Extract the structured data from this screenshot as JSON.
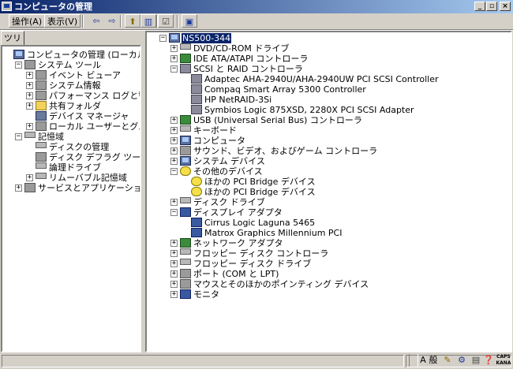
{
  "window": {
    "title": "コンピュータの管理"
  },
  "window_buttons": {
    "minimize": "_",
    "restore": "▫",
    "close": "×"
  },
  "menu": [
    {
      "label": "操作(A)"
    },
    {
      "label": "表示(V)"
    }
  ],
  "toolbar": {
    "back": "⇦",
    "forward": "⇨",
    "up": "⬆",
    "tree": "▥",
    "properties": "☑",
    "help": "▣"
  },
  "left_tab": "ツリー",
  "tree": [
    {
      "label": "コンピュータの管理 (ローカル)",
      "level": 0,
      "expander": "",
      "icon": "computer"
    },
    {
      "label": "システム ツール",
      "level": 1,
      "expander": "−",
      "icon": "tool"
    },
    {
      "label": "イベント ビューア",
      "level": 2,
      "expander": "+",
      "icon": "tool"
    },
    {
      "label": "システム情報",
      "level": 2,
      "expander": "+",
      "icon": "tool"
    },
    {
      "label": "パフォーマンス ログと警告",
      "level": 2,
      "expander": "+",
      "icon": "tool"
    },
    {
      "label": "共有フォルダ",
      "level": 2,
      "expander": "+",
      "icon": "folder"
    },
    {
      "label": "デバイス マネージャ",
      "level": 2,
      "expander": "",
      "icon": "device"
    },
    {
      "label": "ローカル ユーザーとグループ",
      "level": 2,
      "expander": "+",
      "icon": "tool"
    },
    {
      "label": "記憶域",
      "level": 1,
      "expander": "−",
      "icon": "drive"
    },
    {
      "label": "ディスクの管理",
      "level": 2,
      "expander": "",
      "icon": "drive"
    },
    {
      "label": "ディスク デフラグ ツール",
      "level": 2,
      "expander": "",
      "icon": "tool"
    },
    {
      "label": "論理ドライブ",
      "level": 2,
      "expander": "",
      "icon": "drive"
    },
    {
      "label": "リムーバブル記憶域",
      "level": 2,
      "expander": "+",
      "icon": "drive"
    },
    {
      "label": "サービスとアプリケーション",
      "level": 1,
      "expander": "+",
      "icon": "tool"
    }
  ],
  "devices": [
    {
      "label": "NS500-344",
      "level": 0,
      "expander": "−",
      "icon": "computer",
      "selected": true
    },
    {
      "label": "DVD/CD-ROM ドライブ",
      "level": 1,
      "expander": "+",
      "icon": "drive"
    },
    {
      "label": "IDE ATA/ATAPI コントローラ",
      "level": 1,
      "expander": "+",
      "icon": "chip"
    },
    {
      "label": "SCSI と RAID コントローラ",
      "level": 1,
      "expander": "−",
      "icon": "scsi"
    },
    {
      "label": "Adaptec AHA-2940U/AHA-2940UW PCI SCSI Controller",
      "level": 2,
      "expander": "",
      "icon": "scsi"
    },
    {
      "label": "Compaq Smart Array 5300 Controller",
      "level": 2,
      "expander": "",
      "icon": "scsi"
    },
    {
      "label": "HP NetRAID-3Si",
      "level": 2,
      "expander": "",
      "icon": "scsi"
    },
    {
      "label": "Symbios Logic 875XSD, 2280X PCI SCSI Adapter",
      "level": 2,
      "expander": "",
      "icon": "scsi"
    },
    {
      "label": "USB (Universal Serial Bus) コントローラ",
      "level": 1,
      "expander": "+",
      "icon": "chip"
    },
    {
      "label": "キーボード",
      "level": 1,
      "expander": "+",
      "icon": "drive"
    },
    {
      "label": "コンピュータ",
      "level": 1,
      "expander": "+",
      "icon": "computer"
    },
    {
      "label": "サウンド、ビデオ、およびゲーム コントローラ",
      "level": 1,
      "expander": "+",
      "icon": "tool"
    },
    {
      "label": "システム デバイス",
      "level": 1,
      "expander": "+",
      "icon": "computer"
    },
    {
      "label": "その他のデバイス",
      "level": 1,
      "expander": "−",
      "icon": "warn"
    },
    {
      "label": "ほかの PCI Bridge デバイス",
      "level": 2,
      "expander": "",
      "icon": "warn"
    },
    {
      "label": "ほかの PCI Bridge デバイス",
      "level": 2,
      "expander": "",
      "icon": "warn"
    },
    {
      "label": "ディスク ドライブ",
      "level": 1,
      "expander": "+",
      "icon": "drive"
    },
    {
      "label": "ディスプレイ アダプタ",
      "level": 1,
      "expander": "−",
      "icon": "monitor"
    },
    {
      "label": "Cirrus Logic Laguna 5465",
      "level": 2,
      "expander": "",
      "icon": "monitor"
    },
    {
      "label": "Matrox Graphics Millennium PCI",
      "level": 2,
      "expander": "",
      "icon": "monitor"
    },
    {
      "label": "ネットワーク アダプタ",
      "level": 1,
      "expander": "+",
      "icon": "chip"
    },
    {
      "label": "フロッピー ディスク コントローラ",
      "level": 1,
      "expander": "+",
      "icon": "drive"
    },
    {
      "label": "フロッピー ディスク ドライブ",
      "level": 1,
      "expander": "+",
      "icon": "drive"
    },
    {
      "label": "ポート (COM と LPT)",
      "level": 1,
      "expander": "+",
      "icon": "tool"
    },
    {
      "label": "マウスとそのほかのポインティング デバイス",
      "level": 1,
      "expander": "+",
      "icon": "tool"
    },
    {
      "label": "モニタ",
      "level": 1,
      "expander": "+",
      "icon": "monitor"
    }
  ],
  "tray": {
    "ime_a": "A",
    "ime_mode": "般",
    "caps": "CAPS",
    "kana": "KANA"
  },
  "colors": {
    "title_start": "#0a246a",
    "title_end": "#a6caf0",
    "selection": "#0a246a",
    "face": "#d4d0c8"
  }
}
